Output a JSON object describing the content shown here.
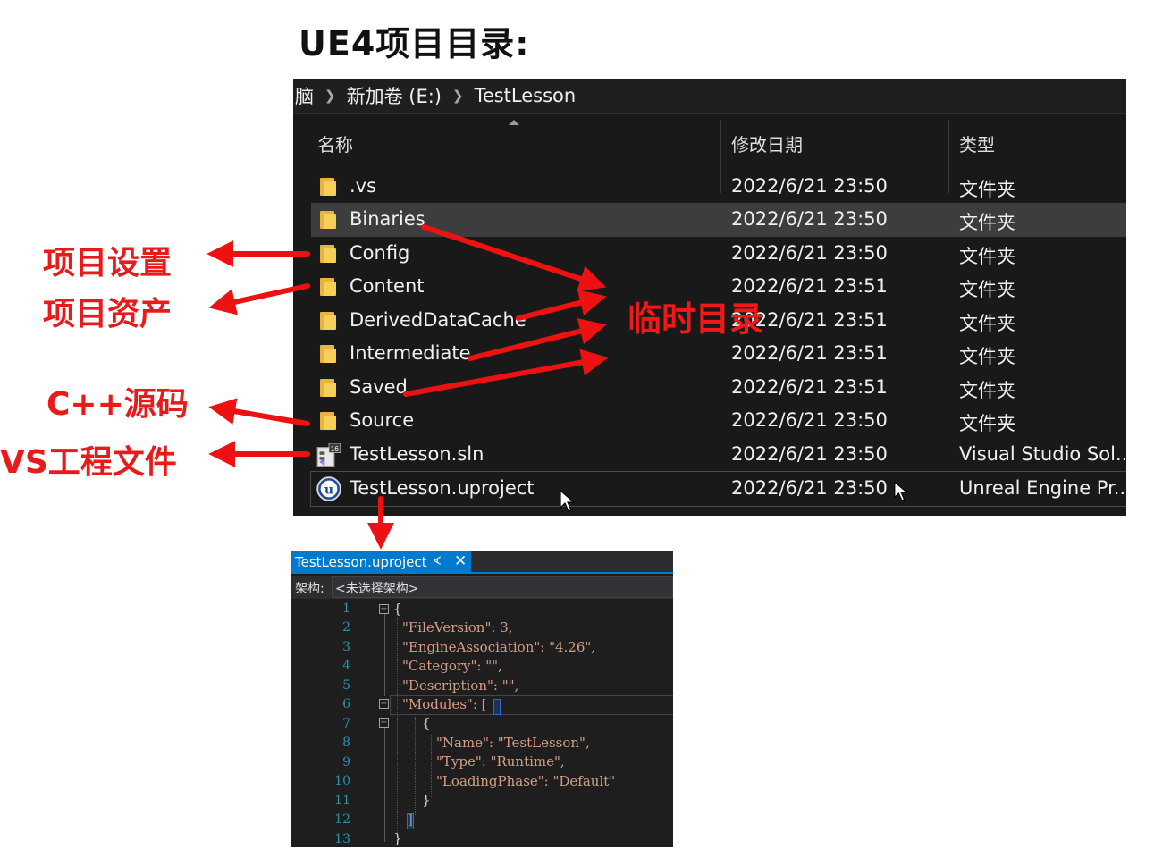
{
  "slide": {
    "title": "UE4项目目录:"
  },
  "explorer": {
    "breadcrumb": [
      "脑",
      "新加卷 (E:)",
      "TestLesson"
    ],
    "columns": {
      "name": "名称",
      "date": "修改日期",
      "type": "类型"
    },
    "rows": [
      {
        "name": ".vs",
        "date": "2022/6/21 23:50",
        "type": "文件夹",
        "icon": "folder-icon"
      },
      {
        "name": "Binaries",
        "date": "2022/6/21 23:50",
        "type": "文件夹",
        "icon": "folder-icon"
      },
      {
        "name": "Config",
        "date": "2022/6/21 23:50",
        "type": "文件夹",
        "icon": "folder-icon"
      },
      {
        "name": "Content",
        "date": "2022/6/21 23:51",
        "type": "文件夹",
        "icon": "folder-icon"
      },
      {
        "name": "DerivedDataCache",
        "date": "2022/6/21 23:51",
        "type": "文件夹",
        "icon": "folder-icon"
      },
      {
        "name": "Intermediate",
        "date": "2022/6/21 23:51",
        "type": "文件夹",
        "icon": "folder-icon"
      },
      {
        "name": "Saved",
        "date": "2022/6/21 23:51",
        "type": "文件夹",
        "icon": "folder-icon"
      },
      {
        "name": "Source",
        "date": "2022/6/21 23:50",
        "type": "文件夹",
        "icon": "folder-icon"
      },
      {
        "name": "TestLesson.sln",
        "date": "2022/6/21 23:50",
        "type": "Visual Studio Sol...",
        "icon": "visual-studio-icon",
        "badge": "16"
      },
      {
        "name": "TestLesson.uproject",
        "date": "2022/6/21 23:50",
        "type": "Unreal Engine Pr...",
        "icon": "unreal-engine-icon",
        "badge": "u"
      }
    ]
  },
  "annotations": {
    "project_settings": "项目设置",
    "project_assets": "项目资产",
    "cpp_source": "C++源码",
    "vs_project": "VS工程文件",
    "temp_dirs": "临时目录"
  },
  "editor": {
    "tab_title": "TestLesson.uproject",
    "pin_glyph": "ᗉ",
    "close_glyph": "✕",
    "arch_label": "架构:",
    "arch_value": "<未选择架构>",
    "line_numbers": [
      "1",
      "2",
      "3",
      "4",
      "5",
      "6",
      "7",
      "8",
      "9",
      "10",
      "11",
      "12",
      "13"
    ],
    "lines": [
      "{",
      "\"FileVersion\": 3,",
      "\"EngineAssociation\": \"4.26\",",
      "\"Category\": \"\",",
      "\"Description\": \"\",",
      "\"Modules\": [",
      "{",
      "\"Name\": \"TestLesson\",",
      "\"Type\": \"Runtime\",",
      "\"LoadingPhase\": \"Default\"",
      "}",
      "]",
      "}"
    ]
  },
  "colors": {
    "annotation_red": "#e81a1a",
    "explorer_bg": "#191919",
    "editor_accent": "#007acc",
    "folder": "#f6cf58"
  }
}
